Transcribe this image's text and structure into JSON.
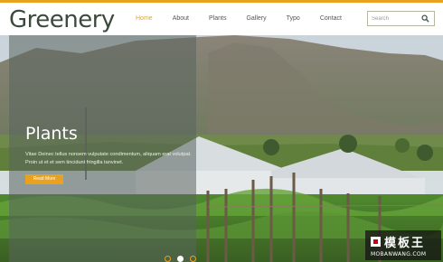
{
  "header": {
    "logo": "Greenery",
    "nav": [
      {
        "label": "Home",
        "active": true
      },
      {
        "label": "About"
      },
      {
        "label": "Plants"
      },
      {
        "label": "Gallery"
      },
      {
        "label": "Typo"
      },
      {
        "label": "Contact"
      }
    ],
    "search_placeholder": "Search"
  },
  "slide": {
    "title": "Plants",
    "text": "Vitae Deinec tellus nonsem vulputate condimentum, aliquam erat volutpat. Proin ut et et sem tincidunt fringilla tanvinet.",
    "button": "Read More"
  },
  "slider": {
    "dots": 3,
    "active_dot": 1
  },
  "watermark": {
    "brand": "模板王",
    "url": "MOBANWANG.COM"
  },
  "colors": {
    "accent": "#e9a21f",
    "logo": "#3b4a3c",
    "overlay": "rgba(90,100,95,0.55)"
  }
}
